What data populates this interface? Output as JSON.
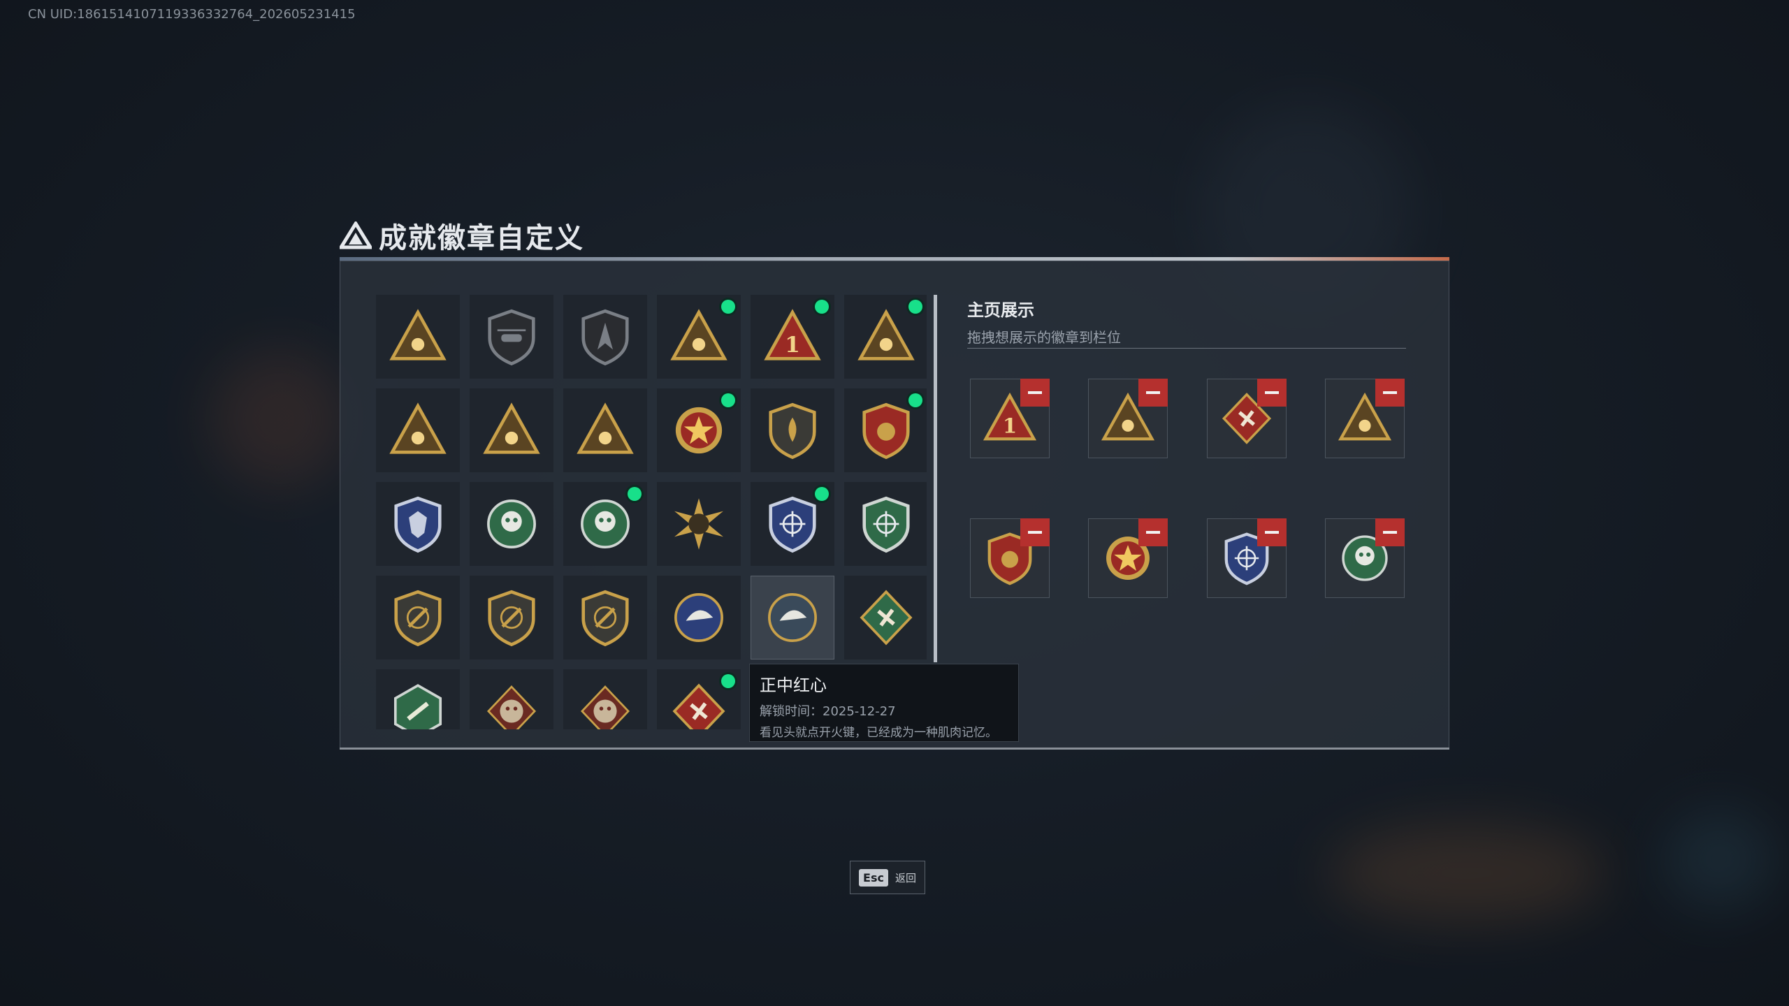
{
  "uid_text": "CN UID:1861514107119336332764_202605231415",
  "page_title": "成就徽章自定义",
  "colors": {
    "accent_dot": "#18e08a",
    "remove_red": "#b5302e",
    "gold": "#c9a14a"
  },
  "badges": [
    {
      "icon": "shield-triangle-badge",
      "new": false
    },
    {
      "icon": "helicopter-badge",
      "new": false
    },
    {
      "icon": "spearhead-shield-badge",
      "new": false
    },
    {
      "icon": "gold-tower-triangle-badge",
      "new": true
    },
    {
      "icon": "number-one-triangle-badge",
      "new": true
    },
    {
      "icon": "kneeling-soldier-triangle-badge",
      "new": true
    },
    {
      "icon": "eye-triangle-badge",
      "new": false
    },
    {
      "icon": "soldier-triangle-badge",
      "new": false
    },
    {
      "icon": "rocket-triangle-badge",
      "new": false
    },
    {
      "icon": "red-star-medal-badge",
      "new": true
    },
    {
      "icon": "flame-shield-badge",
      "new": false
    },
    {
      "icon": "red-gold-star-shield-badge",
      "new": true
    },
    {
      "icon": "blue-wolf-shield-badge",
      "new": false
    },
    {
      "icon": "green-skull-badge",
      "new": false
    },
    {
      "icon": "green-flower-skull-badge",
      "new": true
    },
    {
      "icon": "tank-burst-badge",
      "new": false
    },
    {
      "icon": "blue-crosshair-shield-badge",
      "new": true
    },
    {
      "icon": "green-crosshair-shield-badge",
      "new": false
    },
    {
      "icon": "rifle-shield-badge",
      "new": false
    },
    {
      "icon": "rifle-shield-2-badge",
      "new": false
    },
    {
      "icon": "gold-crossed-rifles-badge",
      "new": false
    },
    {
      "icon": "blue-eagle-badge",
      "new": false
    },
    {
      "icon": "eagle-circle-badge",
      "new": false,
      "hover": true
    },
    {
      "icon": "green-eagle-diamond-badge",
      "new": false
    },
    {
      "icon": "green-hex-rifle-badge",
      "new": false
    },
    {
      "icon": "red-dragon-badge",
      "new": false
    },
    {
      "icon": "red-dragon-2-badge",
      "new": false
    },
    {
      "icon": "red-diamond-soldier-badge",
      "new": true
    }
  ],
  "showcase": {
    "title": "主页展示",
    "subtitle": "拖拽想展示的徽章到栏位",
    "slots": [
      {
        "icon": "number-one-triangle-badge",
        "remove": "remove-icon"
      },
      {
        "icon": "kneeling-soldier-triangle-badge",
        "remove": "remove-icon"
      },
      {
        "icon": "red-diamond-soldier-badge",
        "remove": "remove-icon"
      },
      {
        "icon": "gold-tower-triangle-badge",
        "remove": "remove-icon"
      },
      {
        "icon": "red-gold-star-shield-badge",
        "remove": "remove-icon"
      },
      {
        "icon": "red-star-medal-badge",
        "remove": "remove-icon"
      },
      {
        "icon": "blue-crosshair-shield-badge",
        "remove": "remove-icon"
      },
      {
        "icon": "green-flower-skull-badge",
        "remove": "remove-icon"
      }
    ]
  },
  "tooltip": {
    "title": "正中红心",
    "time_label": "解锁时间：",
    "time_value": "2025-12-27",
    "description": "看见头就点开火键，已经成为一种肌肉记忆。"
  },
  "footer": {
    "key": "Esc",
    "label": "返回"
  }
}
